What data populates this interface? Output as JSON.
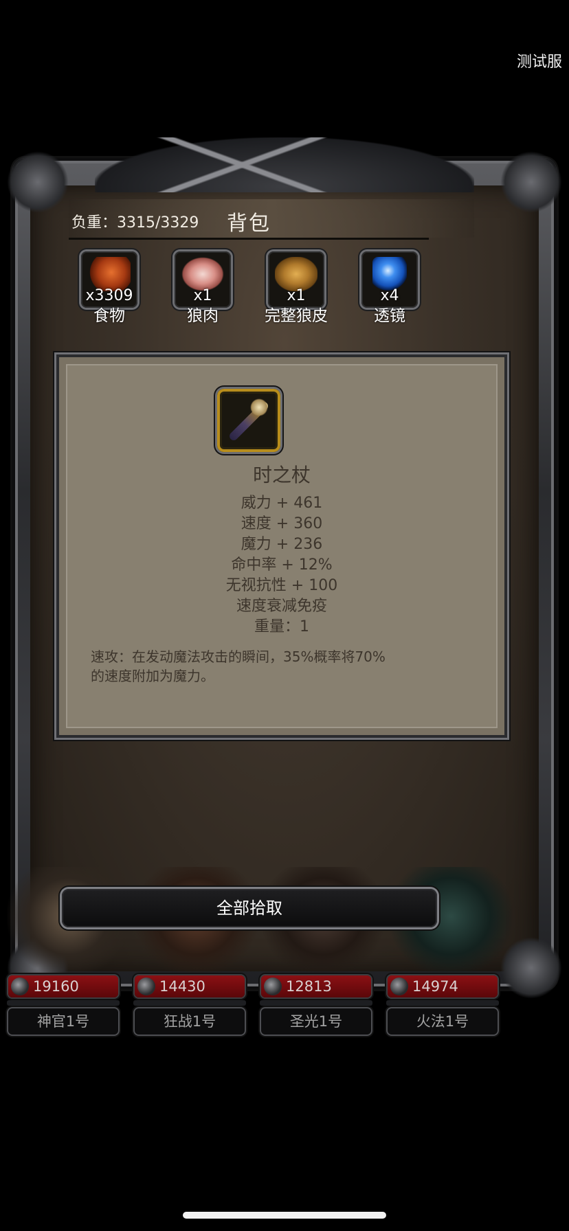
{
  "server": "测试服",
  "bag": {
    "weight": "负重：3315/3329",
    "title": "背包",
    "items": [
      {
        "qty": "x3309",
        "name": "食物",
        "icon": "roast-meat-icon"
      },
      {
        "qty": "x1",
        "name": "狼肉",
        "icon": "raw-meat-icon"
      },
      {
        "qty": "x1",
        "name": "完整狼皮",
        "icon": "wolf-hide-icon"
      },
      {
        "qty": "x4",
        "name": "透镜",
        "icon": "blue-lens-icon"
      }
    ]
  },
  "detail": {
    "icon": "staff-icon",
    "name": "时之杖",
    "stats": [
      "威力 + 461",
      "速度 + 360",
      "魔力 + 236",
      "命中率 + 12%",
      "无视抗性 + 100",
      "速度衰减免疫",
      "重量：1"
    ],
    "description_line1": "速攻：在发动魔法攻击的瞬间，35%概率将70%",
    "description_line2": "的速度附加为魔力。"
  },
  "pickup_all": "全部拾取",
  "party": [
    {
      "hp": "19160",
      "name": "神官1号"
    },
    {
      "hp": "14430",
      "name": "狂战1号"
    },
    {
      "hp": "12813",
      "name": "圣光1号"
    },
    {
      "hp": "14974",
      "name": "火法1号"
    }
  ]
}
